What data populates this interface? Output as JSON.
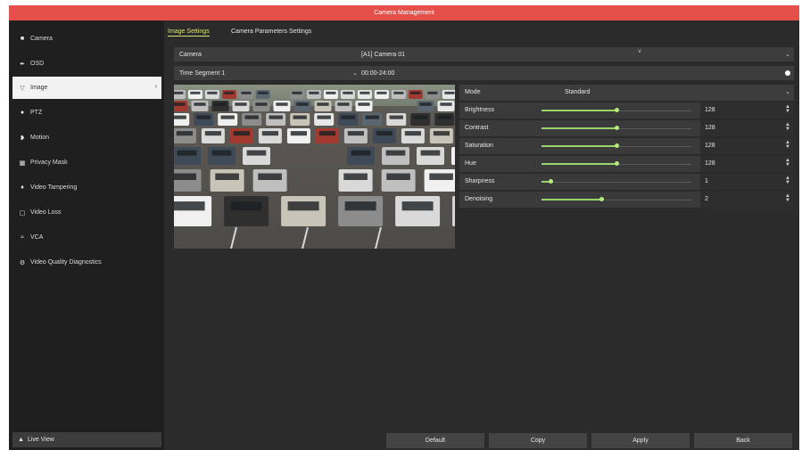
{
  "window": {
    "title": "Camera Management"
  },
  "sidebar": {
    "items": [
      {
        "label": "Camera",
        "icon": "camera-icon"
      },
      {
        "label": "OSD",
        "icon": "pencil-icon"
      },
      {
        "label": "Image",
        "icon": "image-icon",
        "active": true
      },
      {
        "label": "PTZ",
        "icon": "ptz-icon"
      },
      {
        "label": "Motion",
        "icon": "motion-icon"
      },
      {
        "label": "Privacy Mask",
        "icon": "privacy-mask-icon"
      },
      {
        "label": "Video Tampering",
        "icon": "tamper-icon"
      },
      {
        "label": "Video Loss",
        "icon": "video-loss-icon"
      },
      {
        "label": "VCA",
        "icon": "vca-icon"
      },
      {
        "label": "Video Quality Diagnostics",
        "icon": "diagnostics-icon"
      }
    ],
    "live_view": "Live View"
  },
  "tabs": [
    {
      "label": "Image Settings",
      "active": true
    },
    {
      "label": "Camera Parameters Settings",
      "active": false
    }
  ],
  "fields": {
    "camera_label": "Camera",
    "camera_value": "[A1] Camera 01",
    "time_segment_label": "Time Segment 1",
    "time_segment_value": "00:00-24:00"
  },
  "image_params": {
    "mode_label": "Mode",
    "mode_value": "Standard",
    "sliders": [
      {
        "label": "Brightness",
        "value": "128",
        "level": 0.5
      },
      {
        "label": "Contrast",
        "value": "128",
        "level": 0.5
      },
      {
        "label": "Saturation",
        "value": "128",
        "level": 0.5
      },
      {
        "label": "Hue",
        "value": "128",
        "level": 0.5
      },
      {
        "label": "Sharpness",
        "value": "1",
        "level": 0.06
      },
      {
        "label": "Denoising",
        "value": "2",
        "level": 0.4
      }
    ]
  },
  "buttons": {
    "default": "Default",
    "copy": "Copy",
    "apply": "Apply",
    "back": "Back"
  },
  "colors": {
    "title_bar": "#e5504a",
    "accent": "#d8e078",
    "slider": "#9bd36a"
  }
}
